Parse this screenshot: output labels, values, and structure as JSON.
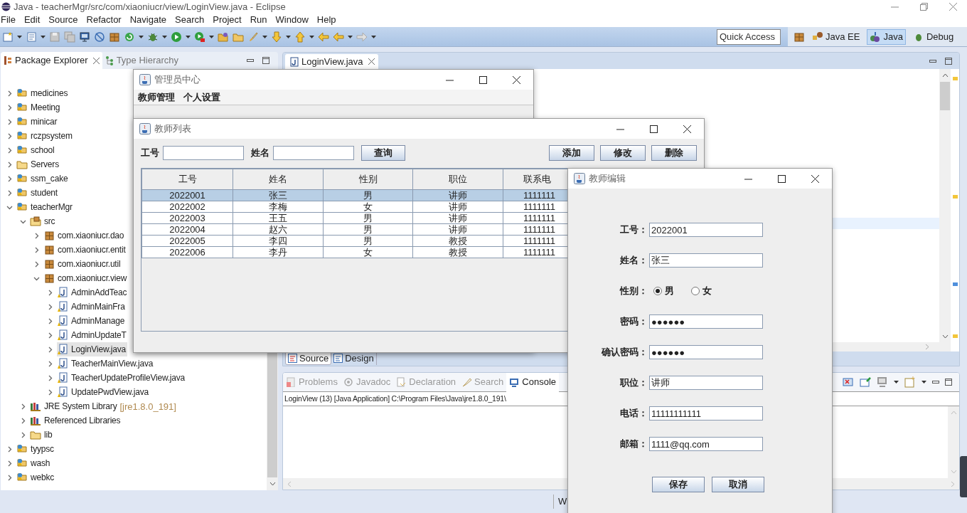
{
  "window": {
    "title": "Java - teacherMgr/src/com/xiaoniucr/view/LoginView.java - Eclipse"
  },
  "menu": [
    "File",
    "Edit",
    "Source",
    "Refactor",
    "Navigate",
    "Search",
    "Project",
    "Run",
    "Window",
    "Help"
  ],
  "quick_access": {
    "placeholder": "Quick Access"
  },
  "perspectives": [
    {
      "label": "Java EE",
      "selected": false
    },
    {
      "label": "Java",
      "selected": true
    },
    {
      "label": "Debug",
      "selected": false
    }
  ],
  "left_tabs": [
    {
      "label": "Package Explorer",
      "selected": true
    },
    {
      "label": "Type Hierarchy",
      "selected": false
    }
  ],
  "tree": [
    {
      "label": "medicines",
      "kind": "project",
      "expanded": false,
      "selected": false
    },
    {
      "label": "Meeting",
      "kind": "project",
      "expanded": false,
      "selected": false
    },
    {
      "label": "minicar",
      "kind": "project",
      "expanded": false,
      "selected": false
    },
    {
      "label": "rczpsystem",
      "kind": "project",
      "expanded": false,
      "selected": false
    },
    {
      "label": "school",
      "kind": "project",
      "expanded": false,
      "selected": false
    },
    {
      "label": "Servers",
      "kind": "folder",
      "expanded": false,
      "selected": false
    },
    {
      "label": "ssm_cake",
      "kind": "project",
      "expanded": false,
      "selected": false
    },
    {
      "label": "student",
      "kind": "project",
      "expanded": false,
      "selected": false
    },
    {
      "label": "teacherMgr",
      "kind": "project",
      "expanded": true,
      "selected": false,
      "children": [
        {
          "label": "src",
          "kind": "source",
          "expanded": true,
          "selected": false,
          "children": [
            {
              "label": "com.xiaoniucr.dao",
              "kind": "package",
              "expanded": false,
              "selected": false
            },
            {
              "label": "com.xiaoniucr.entit",
              "kind": "package",
              "expanded": false,
              "selected": false
            },
            {
              "label": "com.xiaoniucr.util",
              "kind": "package",
              "expanded": false,
              "selected": false
            },
            {
              "label": "com.xiaoniucr.view",
              "kind": "package",
              "expanded": true,
              "selected": false,
              "children": [
                {
                  "label": "AdminAddTeac",
                  "kind": "java",
                  "expanded": false,
                  "selected": false
                },
                {
                  "label": "AdminMainFra",
                  "kind": "java",
                  "expanded": false,
                  "selected": false
                },
                {
                  "label": "AdminManage",
                  "kind": "java",
                  "expanded": false,
                  "selected": false
                },
                {
                  "label": "AdminUpdateT",
                  "kind": "java",
                  "expanded": false,
                  "selected": false
                },
                {
                  "label": "LoginView.java",
                  "kind": "java",
                  "expanded": false,
                  "selected": true
                },
                {
                  "label": "TeacherMainView.java",
                  "kind": "java",
                  "expanded": false,
                  "selected": false
                },
                {
                  "label": "TeacherUpdateProfileView.java",
                  "kind": "java",
                  "expanded": false,
                  "selected": false
                },
                {
                  "label": "UpdatePwdView.java",
                  "kind": "java",
                  "expanded": false,
                  "selected": false
                }
              ]
            }
          ]
        },
        {
          "label": "JRE System Library",
          "decoration": "[jre1.8.0_191]",
          "kind": "library",
          "expanded": false,
          "selected": false
        },
        {
          "label": "Referenced Libraries",
          "kind": "library",
          "expanded": false,
          "selected": false
        },
        {
          "label": "lib",
          "kind": "folder",
          "expanded": false,
          "selected": false
        }
      ]
    },
    {
      "label": "tyypsc",
      "kind": "project",
      "expanded": false,
      "selected": false
    },
    {
      "label": "wash",
      "kind": "project",
      "expanded": false,
      "selected": false
    },
    {
      "label": "webkc",
      "kind": "project",
      "expanded": false,
      "selected": false
    }
  ],
  "editor_tab": {
    "label": "LoginView.java"
  },
  "editor_mode_tabs": [
    {
      "label": "Source",
      "selected": true
    },
    {
      "label": "Design",
      "selected": false
    }
  ],
  "bottom_tabs": [
    {
      "label": "Problems",
      "selected": false
    },
    {
      "label": "Javadoc",
      "selected": false
    },
    {
      "label": "Declaration",
      "selected": false
    },
    {
      "label": "Search",
      "selected": false
    },
    {
      "label": "Console",
      "selected": true
    }
  ],
  "console_line": "LoginView (13) [Java Application] C:\\Program Files\\Java\\jre1.8.0_191\\",
  "status_bar": {
    "text": "W"
  },
  "admin_window": {
    "title": "管理员中心",
    "menu": [
      "教师管理",
      "个人设置"
    ]
  },
  "list_window": {
    "title": "教师列表",
    "search_fields": [
      {
        "label": "工号"
      },
      {
        "label": "姓名"
      }
    ],
    "search_button": "查询",
    "actions": [
      "添加",
      "修改",
      "删除"
    ],
    "table": {
      "columns": [
        "工号",
        "姓名",
        "性别",
        "职位",
        "联系电"
      ],
      "rows": [
        {
          "cells": [
            "2022001",
            "张三",
            "男",
            "讲师",
            "1111111"
          ],
          "selected": true
        },
        {
          "cells": [
            "2022002",
            "李梅",
            "女",
            "讲师",
            "1111111"
          ],
          "selected": false
        },
        {
          "cells": [
            "2022003",
            "王五",
            "男",
            "讲师",
            "1111111"
          ],
          "selected": false
        },
        {
          "cells": [
            "2022004",
            "赵六",
            "男",
            "讲师",
            "1111111"
          ],
          "selected": false
        },
        {
          "cells": [
            "2022005",
            "李四",
            "男",
            "教授",
            "1111111"
          ],
          "selected": false
        },
        {
          "cells": [
            "2022006",
            "李丹",
            "女",
            "教授",
            "1111111"
          ],
          "selected": false
        }
      ]
    }
  },
  "edit_window": {
    "title": "教师编辑",
    "fields": [
      {
        "kind": "text",
        "label": "工号：",
        "value": "2022001"
      },
      {
        "kind": "text",
        "label": "姓名：",
        "value": "张三"
      },
      {
        "kind": "radio",
        "label": "性别：",
        "options": [
          {
            "label": "男",
            "selected": true
          },
          {
            "label": "女",
            "selected": false
          }
        ]
      },
      {
        "kind": "text",
        "label": "密码：",
        "value": "●●●●●●"
      },
      {
        "kind": "text",
        "label": "确认密码：",
        "value": "●●●●●●"
      },
      {
        "kind": "text",
        "label": "职位：",
        "value": "讲师"
      },
      {
        "kind": "text",
        "label": "电话：",
        "value": "11111111111"
      },
      {
        "kind": "text",
        "label": "邮箱：",
        "value": "1111@qq.com"
      }
    ],
    "buttons": [
      "保存",
      "取消"
    ]
  }
}
